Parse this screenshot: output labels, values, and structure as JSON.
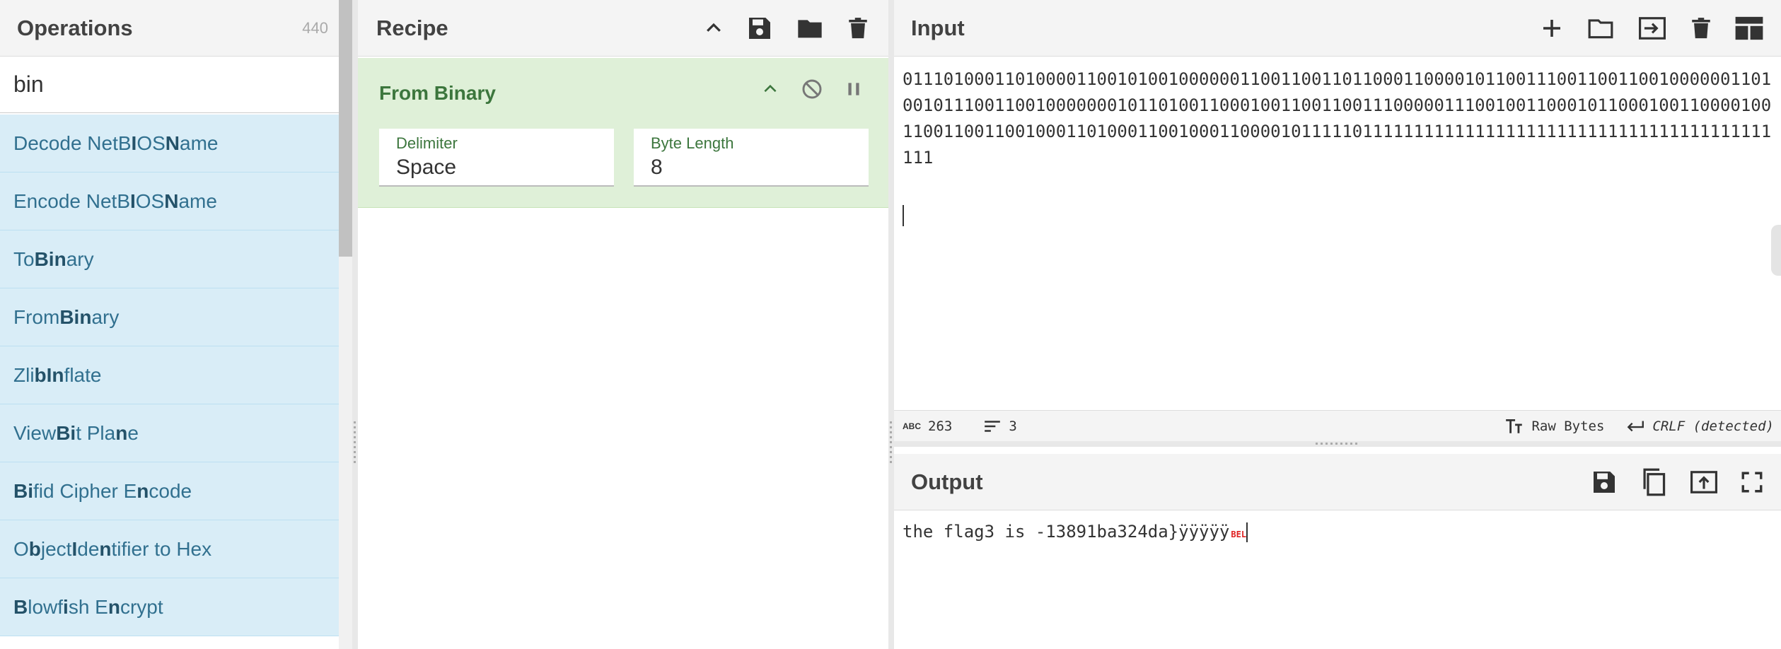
{
  "operations": {
    "title": "Operations",
    "count": "440",
    "search_value": "bin",
    "items": [
      {
        "parts": [
          [
            "Decode NetB",
            false
          ],
          [
            "I",
            true
          ],
          [
            "OS ",
            false
          ],
          [
            "N",
            true
          ],
          [
            "ame",
            false
          ]
        ]
      },
      {
        "parts": [
          [
            "Encode NetB",
            false
          ],
          [
            "I",
            true
          ],
          [
            "OS ",
            false
          ],
          [
            "N",
            true
          ],
          [
            "ame",
            false
          ]
        ]
      },
      {
        "parts": [
          [
            "To ",
            false
          ],
          [
            "Bin",
            true
          ],
          [
            "ary",
            false
          ]
        ]
      },
      {
        "parts": [
          [
            "From ",
            false
          ],
          [
            "Bin",
            true
          ],
          [
            "ary",
            false
          ]
        ]
      },
      {
        "parts": [
          [
            "Zli",
            false
          ],
          [
            "b",
            true
          ],
          [
            " ",
            false
          ],
          [
            "In",
            true
          ],
          [
            "flate",
            false
          ]
        ]
      },
      {
        "parts": [
          [
            "View ",
            false
          ],
          [
            "Bi",
            true
          ],
          [
            "t Pla",
            false
          ],
          [
            "n",
            true
          ],
          [
            "e",
            false
          ]
        ]
      },
      {
        "parts": [
          [
            "Bi",
            true
          ],
          [
            "fid Cipher E",
            false
          ],
          [
            "n",
            true
          ],
          [
            "code",
            false
          ]
        ]
      },
      {
        "parts": [
          [
            "O",
            false
          ],
          [
            "b",
            true
          ],
          [
            "ject ",
            false
          ],
          [
            "I",
            true
          ],
          [
            "de",
            false
          ],
          [
            "n",
            true
          ],
          [
            "tifier to Hex",
            false
          ]
        ]
      },
      {
        "parts": [
          [
            "B",
            true
          ],
          [
            "lowf",
            false
          ],
          [
            "i",
            true
          ],
          [
            "sh E",
            false
          ],
          [
            "n",
            true
          ],
          [
            "crypt",
            false
          ]
        ]
      }
    ]
  },
  "recipe": {
    "title": "Recipe",
    "operation": {
      "name": "From Binary",
      "args": [
        {
          "label": "Delimiter",
          "value": "Space"
        },
        {
          "label": "Byte Length",
          "value": "8"
        }
      ]
    }
  },
  "input": {
    "title": "Input",
    "text": "011101000110100001100101001000000110011001101100011000010110011100110011001000000110100101110011001000000010110100110001001100110011100000111001001100010110001001100001001100110011001000110100011001000110000101111101111111111111111111111111111111111111111111",
    "stats": {
      "chars": "263",
      "lines": "3",
      "encoding": "Raw Bytes",
      "eol": "CRLF (detected)"
    }
  },
  "output": {
    "title": "Output",
    "text": "the flag3 is -13891ba324da}ÿÿÿÿÿ",
    "control_char": "BEL"
  },
  "colors": {
    "op_bg": "#d9edf7",
    "op_text": "#31708f",
    "recipe_bg": "#dff0d8",
    "recipe_text": "#3c763d"
  }
}
